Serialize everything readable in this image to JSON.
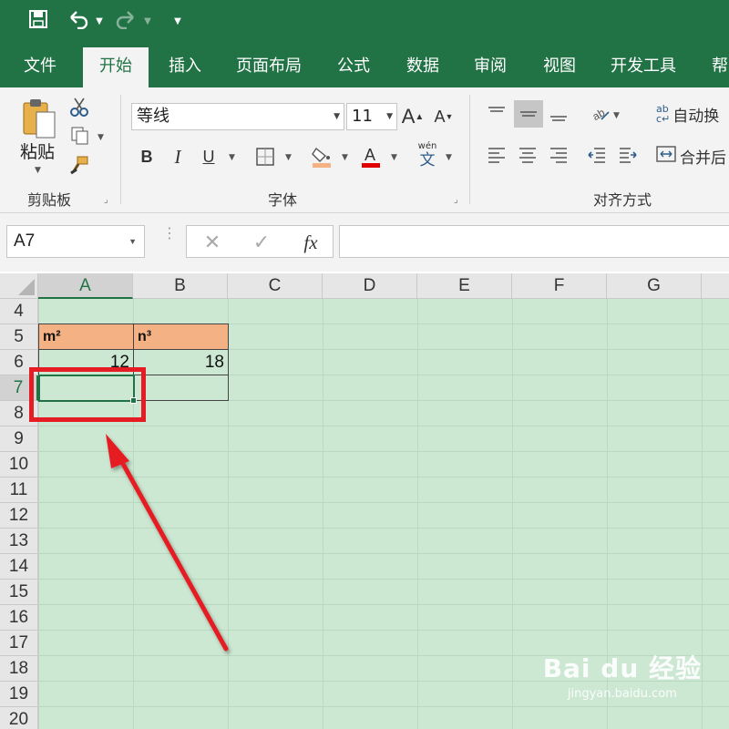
{
  "quick_access": {
    "save_icon": "save-icon",
    "undo_icon": "undo-icon",
    "redo_icon": "redo-icon",
    "customize_icon": "customize-icon"
  },
  "tabs": [
    {
      "label": "文件",
      "active": false
    },
    {
      "label": "开始",
      "active": true
    },
    {
      "label": "插入",
      "active": false
    },
    {
      "label": "页面布局",
      "active": false
    },
    {
      "label": "公式",
      "active": false
    },
    {
      "label": "数据",
      "active": false
    },
    {
      "label": "审阅",
      "active": false
    },
    {
      "label": "视图",
      "active": false
    },
    {
      "label": "开发工具",
      "active": false
    },
    {
      "label": "帮",
      "active": false
    }
  ],
  "ribbon": {
    "clipboard": {
      "paste_label": "粘贴",
      "group_label": "剪贴板"
    },
    "font": {
      "font_name": "等线",
      "font_size": "11",
      "group_label": "字体",
      "bold": "B",
      "italic": "I",
      "underline": "U",
      "phonetic_top": "wén",
      "phonetic_bottom": "文"
    },
    "alignment": {
      "wrap_text": "自动换",
      "merge_center": "合并后",
      "group_label": "对齐方式"
    }
  },
  "formula_bar": {
    "name_box": "A7",
    "fx": "fx",
    "value": ""
  },
  "grid": {
    "columns": [
      "A",
      "B",
      "C",
      "D",
      "E",
      "F",
      "G"
    ],
    "rows": [
      "4",
      "5",
      "6",
      "7",
      "8",
      "9",
      "10",
      "11",
      "12",
      "13",
      "14",
      "15",
      "16",
      "17",
      "18",
      "19",
      "20"
    ],
    "selected_cell": "A7",
    "cells": {
      "A5": "m²",
      "B5": "n³",
      "A6": "12",
      "B6": "18"
    }
  },
  "colors": {
    "excel_green": "#217346",
    "header_fill": "#f4b183",
    "sheet_bg": "#cce8d2",
    "annotation_red": "#e51c23"
  },
  "watermark": {
    "logo": "Bai du 经验",
    "url": "jingyan.baidu.com"
  }
}
